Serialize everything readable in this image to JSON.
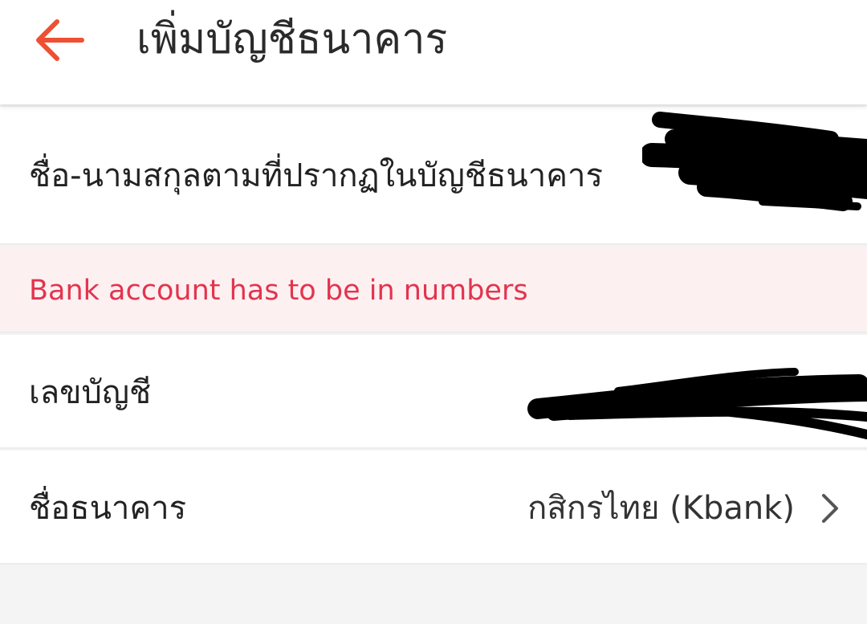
{
  "header": {
    "title": "เพิ่มบัญชีธนาคาร",
    "back_icon": "arrow-left-icon",
    "accent_color": "#ee5033"
  },
  "form": {
    "name_label": "ชื่อ-นามสกุลตามที่ปรากฏในบัญชีธนาคาร",
    "error_message": "Bank account has to be in numbers",
    "error_color": "#e3344e",
    "account_label": "เลขบัญชี",
    "bank_label": "ชื่อธนาคาร",
    "bank_value": "กสิกรไทย (Kbank)",
    "bank_chevron_icon": "chevron-right-icon"
  }
}
